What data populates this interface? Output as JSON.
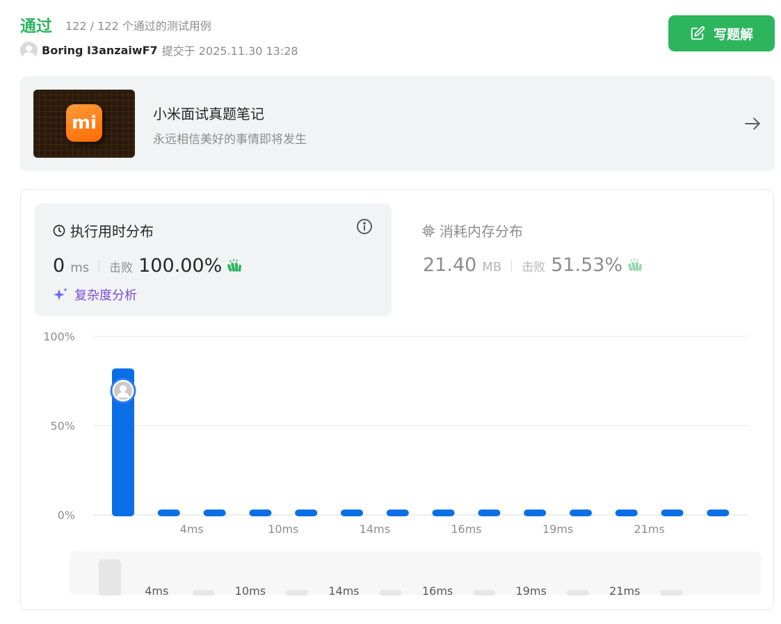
{
  "header": {
    "status": "通过",
    "tests_summary": "122 / 122 个通过的测试用例",
    "username": "Boring I3anzaiwF7",
    "submitted_at": "提交于 2025.11.30 13:28",
    "write_solution_label": "写题解"
  },
  "promo": {
    "logo_text": "mi",
    "title": "小米面试真题笔记",
    "subtitle": "永远相信美好的事情即将发生"
  },
  "runtime": {
    "title": "执行用时分布",
    "value": "0",
    "unit": "ms",
    "beats_label": "击败",
    "beats_pct": "100.00%",
    "complexity_label": "复杂度分析"
  },
  "memory": {
    "title": "消耗内存分布",
    "value": "21.40",
    "unit": "MB",
    "beats_label": "击败",
    "beats_pct": "51.53%"
  },
  "colors": {
    "accepted": "#2db55d",
    "bar": "#0a6ee6",
    "complexity": "#7b4dd6"
  },
  "chart_data": {
    "type": "bar",
    "ylim": [
      0,
      100
    ],
    "y_ticks": [
      "100%",
      "50%",
      "0%"
    ],
    "x_ticks": [
      "4ms",
      "10ms",
      "14ms",
      "16ms",
      "19ms",
      "21ms"
    ],
    "values": [
      82,
      3,
      3,
      3,
      3,
      3,
      3,
      3,
      3,
      3,
      3,
      3,
      3,
      3
    ],
    "highlight_index": 0,
    "grid": true
  }
}
